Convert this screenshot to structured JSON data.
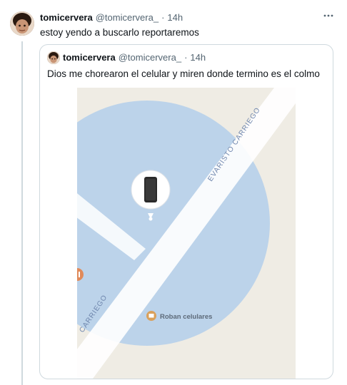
{
  "tweet": {
    "author_name": "tomicervera",
    "author_handle": "@tomicervera_",
    "separator": "·",
    "time": "14h",
    "text": "estoy yendo a buscarlo reportaremos",
    "more_icon": "more-horizontal-icon"
  },
  "quoted_tweet": {
    "author_name": "tomicervera",
    "author_handle": "@tomicervera_",
    "separator": "·",
    "time": "14h",
    "text": "Dios me chorearon el celular y miren donde termino es el colmo",
    "map": {
      "street_label_upper": "EVARISTO CARRIEGO",
      "street_label_lower": "CARRIEGO",
      "place_label": "Roban celulares",
      "pin_icon": "phone-icon",
      "place_icon": "store-icon",
      "colors": {
        "background": "#efece4",
        "radius_circle": "#bcd3ea",
        "road": "#ffffff",
        "pin_bubble": "#ffffff",
        "device": "#2b2b2b",
        "accent_marker": "#e08a5a"
      }
    }
  }
}
